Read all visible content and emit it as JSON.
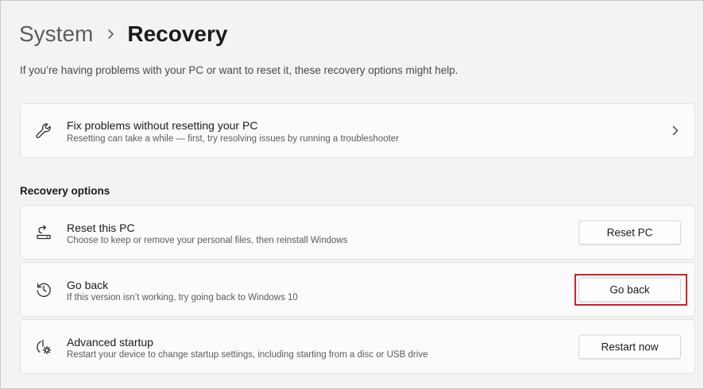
{
  "breadcrumb": {
    "parent": "System",
    "separator_icon": "chevron-right-icon",
    "current": "Recovery"
  },
  "intro": "If you’re having problems with your PC or want to reset it, these recovery options might help.",
  "fix_card": {
    "icon": "wrench-icon",
    "title": "Fix problems without resetting your PC",
    "description": "Resetting can take a while — first, try resolving issues by running a troubleshooter",
    "action_icon": "chevron-right-icon"
  },
  "recovery_options": {
    "heading": "Recovery options",
    "items": [
      {
        "icon": "reset-pc-icon",
        "title": "Reset this PC",
        "description": "Choose to keep or remove your personal files, then reinstall Windows",
        "button": "Reset PC"
      },
      {
        "icon": "history-icon",
        "title": "Go back",
        "description": "If this version isn’t working, try going back to Windows 10",
        "button": "Go back",
        "highlighted": true
      },
      {
        "icon": "advanced-startup-icon",
        "title": "Advanced startup",
        "description": "Restart your device to change startup settings, including starting from a disc or USB drive",
        "button": "Restart now"
      }
    ]
  },
  "colors": {
    "background": "#f3f3f3",
    "card": "#fbfbfb",
    "highlight": "#d0202a"
  }
}
